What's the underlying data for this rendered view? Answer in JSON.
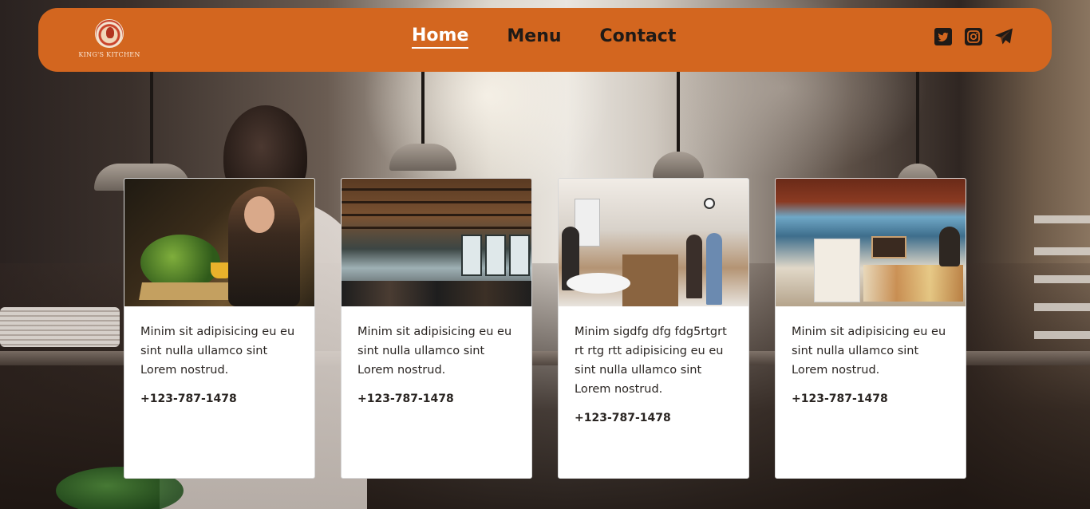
{
  "brand": {
    "name": "KING'S KITCHEN",
    "accent": "#d3661f"
  },
  "nav": {
    "items": [
      {
        "label": "Home",
        "active": true
      },
      {
        "label": "Menu",
        "active": false
      },
      {
        "label": "Contact",
        "active": false
      }
    ]
  },
  "socials": [
    {
      "icon": "twitter-icon"
    },
    {
      "icon": "instagram-icon"
    },
    {
      "icon": "telegram-icon"
    }
  ],
  "cards": [
    {
      "image": "woman-dining-photo",
      "text": "Minim sit adipisicing eu eu sint nulla ullamco sint Lorem nostrud.",
      "phone": "+123-787-1478"
    },
    {
      "image": "restaurant-interior-photo",
      "text": "Minim sit adipisicing eu eu sint nulla ullamco sint Lorem nostrud.",
      "phone": "+123-787-1478"
    },
    {
      "image": "cafe-counter-photo",
      "text": "Minim sigdfg dfg fdg5rtgrt rt rtg rtt adipisicing eu eu sint nulla ullamco sint Lorem nostrud.",
      "phone": "+123-787-1478"
    },
    {
      "image": "coffee-shop-display-photo",
      "text": "Minim sit adipisicing eu eu sint nulla ullamco sint Lorem nostrud.",
      "phone": "+123-787-1478"
    }
  ]
}
